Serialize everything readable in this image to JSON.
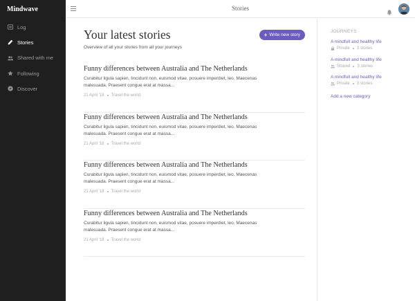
{
  "brand": "Mindwave",
  "nav": [
    {
      "label": "Log",
      "icon": "log-icon",
      "active": false
    },
    {
      "label": "Stories",
      "icon": "pencil-icon",
      "active": true
    },
    {
      "label": "Shared with me",
      "icon": "users-icon",
      "active": false
    },
    {
      "label": "Following",
      "icon": "star-icon",
      "active": false
    },
    {
      "label": "Discover",
      "icon": "compass-icon",
      "active": false
    }
  ],
  "topbar": {
    "title": "Stories"
  },
  "main": {
    "title": "Your latest stories",
    "subtitle": "Overview of all your stories from all your journeys",
    "write_button": "Write new story",
    "stories": [
      {
        "title": "Funny differences between Australia and The Netherlands",
        "excerpt": "Curabitur ligula sapien, tincidunt non, euismod vitae, posuere imperdiet, leo. Maecenas malesuada. Praesent congue erat at massa...",
        "date": "21 April '18",
        "journey": "Travel the world"
      },
      {
        "title": "Funny differences between Australia and The Netherlands",
        "excerpt": "Curabitur ligula sapien, tincidunt non, euismod vitae, posuere imperdiet, leo. Maecenas malesuada. Praesent congue erat at massa...",
        "date": "21 April '18",
        "journey": "Travel the world"
      },
      {
        "title": "Funny differences between Australia and The Netherlands",
        "excerpt": "Curabitur ligula sapien, tincidunt non, euismod vitae, posuere imperdiet, leo. Maecenas malesuada. Praesent congue erat at massa...",
        "date": "21 April '18",
        "journey": "Travel the world"
      },
      {
        "title": "Funny differences between Australia and The Netherlands",
        "excerpt": "Curabitur ligula sapien, tincidunt non, euismod vitae, posuere imperdiet, leo. Maecenas malesuada. Praesent congue erat at massa...",
        "date": "21 April '18",
        "journey": "Travel the world"
      }
    ]
  },
  "journeys": {
    "heading": "JOURNEYS",
    "items": [
      {
        "title": "A mindfull and healthy life",
        "visibility": "Private",
        "visibility_icon": "lock-icon",
        "count": "3 stories"
      },
      {
        "title": "A mindfull and healthy life",
        "visibility": "Shared",
        "visibility_icon": "users-icon",
        "count": "3 stories"
      },
      {
        "title": "A mindfull and healthy life",
        "visibility": "Private",
        "visibility_icon": "users-icon",
        "count": "3 stories"
      }
    ],
    "add_label": "Add a new category"
  },
  "colors": {
    "accent": "#6a5cc0",
    "sidebar_bg": "#1f1f1f"
  }
}
